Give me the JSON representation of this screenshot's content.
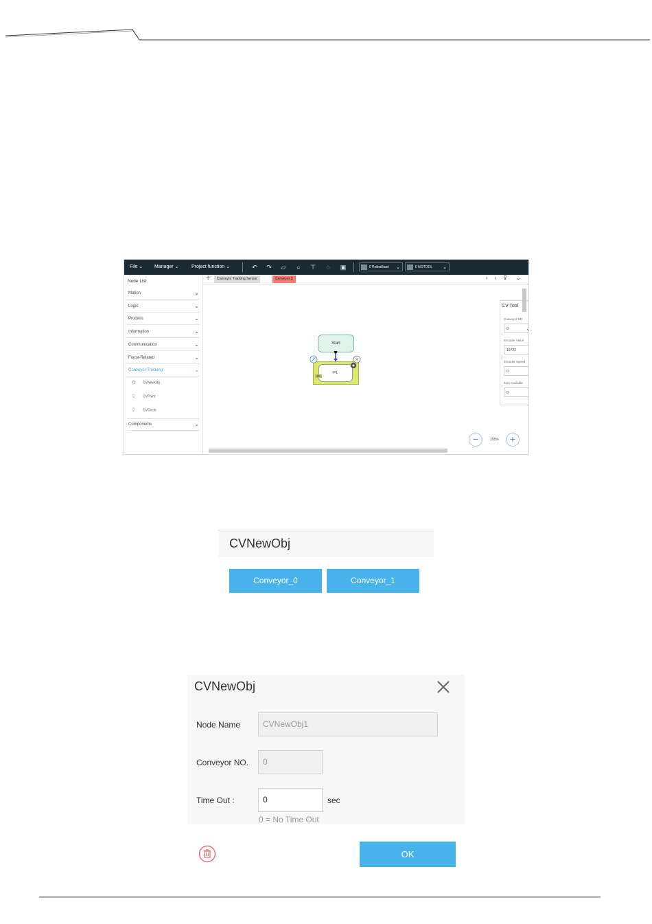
{
  "app": {
    "menu": [
      "File",
      "Manager",
      "Project function"
    ],
    "robot_base_select": "0 RobotBase",
    "tool_select": "0 NOTOOL",
    "node_list": {
      "title": "Node List",
      "categories": [
        "Motion",
        "Logic",
        "Process",
        "Information",
        "Communication",
        "Force-Related",
        "Conveyor Tracking"
      ],
      "sub_items": [
        "CVNewObj",
        "CVPoint",
        "CVCircle"
      ],
      "last_category": "Components"
    },
    "tabs": [
      "Conveyor Tracking Sensor",
      "Conveyor 0"
    ],
    "cv_tool": {
      "title": "CV Tool",
      "conveyor_no_label": "Conveyor NO.",
      "conveyor_no_value": "0",
      "encoder_value_label": "Encoder Value",
      "encoder_value": "19722",
      "encoder_speed_label": "Encoder Speed",
      "encoder_speed": "0",
      "item_available_label": "Item Available",
      "item_available": "0"
    },
    "flow": {
      "start_label": "Start",
      "node_label": "P1",
      "node_badge": "3D"
    },
    "zoom_level": "155%"
  },
  "conveyor_select": {
    "title": "CVNewObj",
    "buttons": [
      "Conveyor_0",
      "Conveyor_1"
    ]
  },
  "dialog": {
    "title": "CVNewObj",
    "node_name_label": "Node Name",
    "node_name_value": "CVNewObj1",
    "conveyor_no_label": "Conveyor NO.",
    "conveyor_no_value": "0",
    "timeout_label": "Time Out :",
    "timeout_value": "0",
    "timeout_unit": "sec",
    "timeout_hint": "0 = No Time Out",
    "ok_label": "OK"
  },
  "colors": {
    "accent": "#47b3ea",
    "toolbar": "#1b2b36",
    "active_tab": "#f27a6e",
    "delete": "#e57373"
  }
}
